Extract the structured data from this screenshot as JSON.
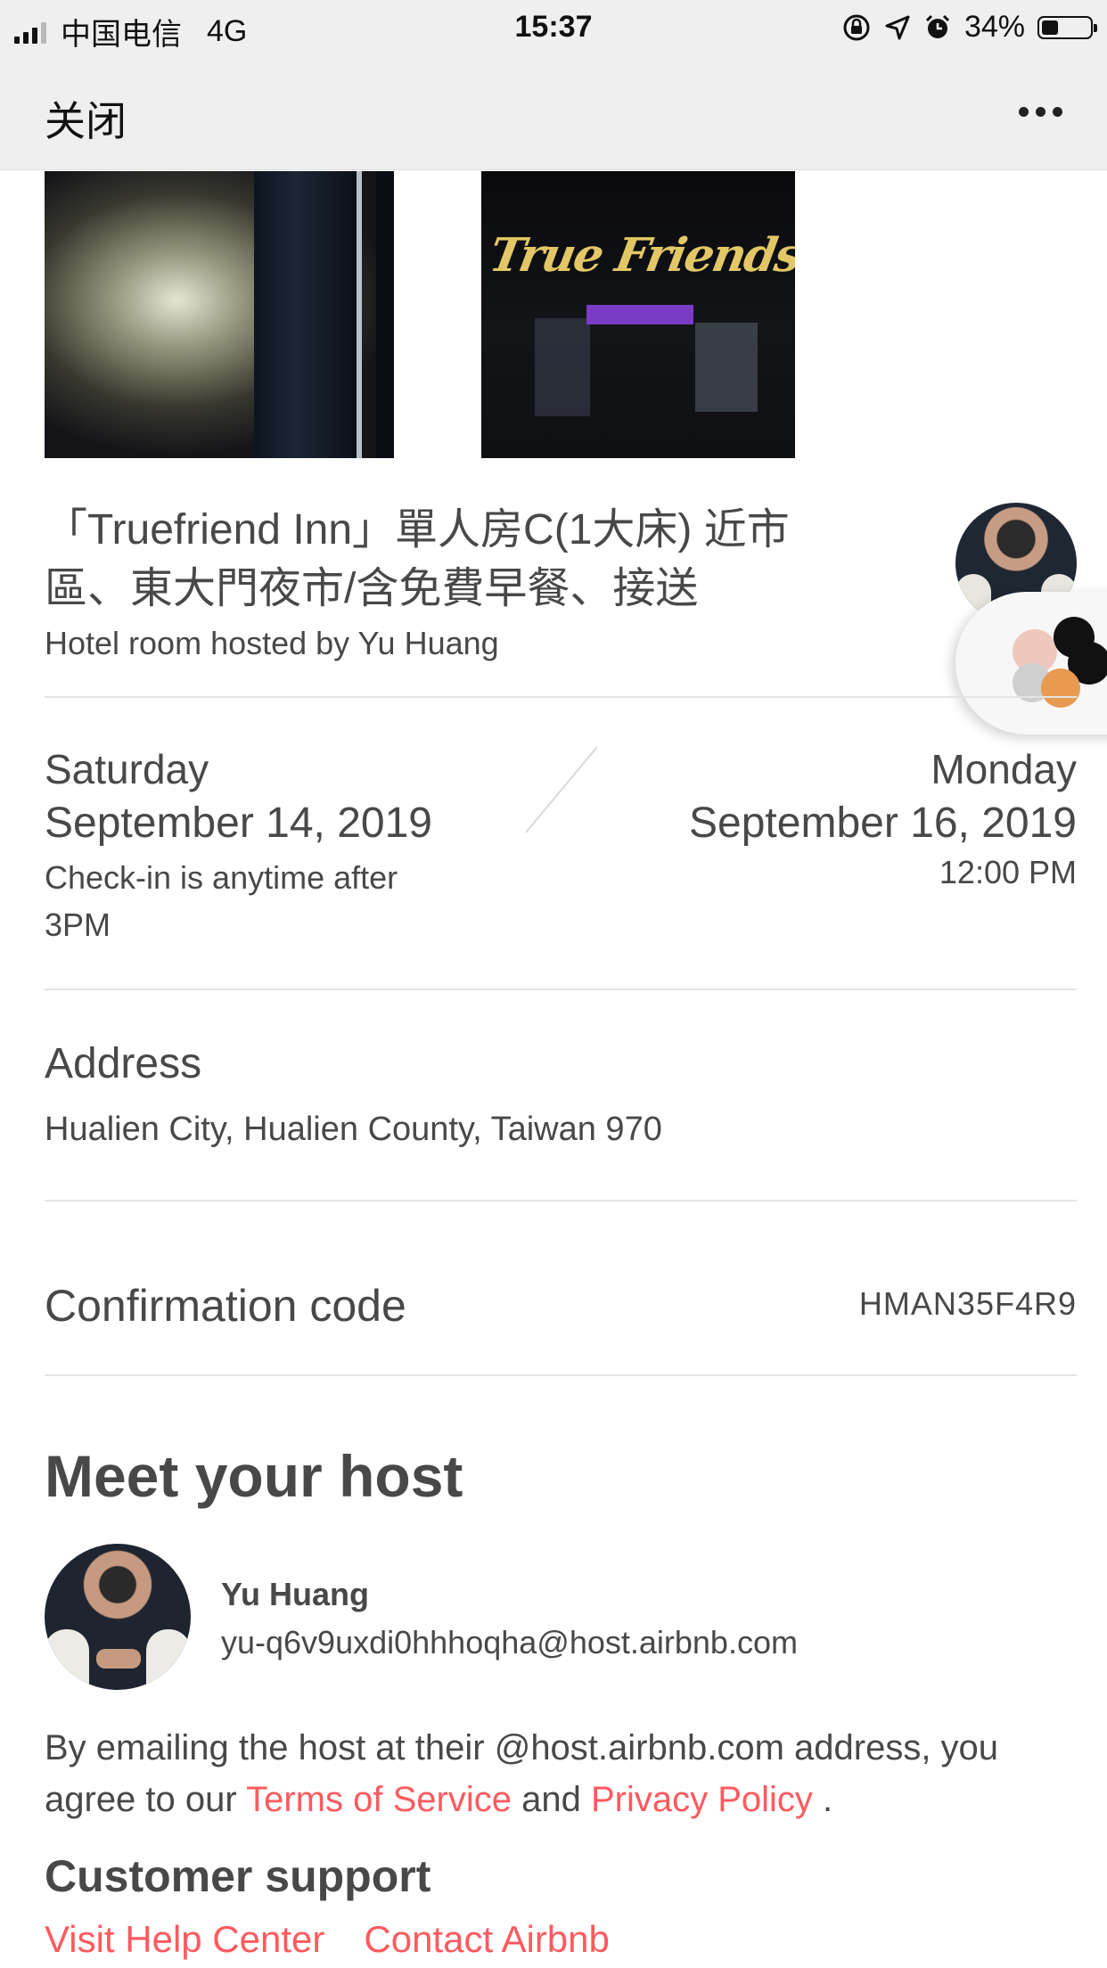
{
  "status_bar": {
    "carrier": "中国电信",
    "network": "4G",
    "time": "15:37",
    "battery": "34%",
    "battery_level": 0.34,
    "icons": [
      "signal-icon",
      "orientation-lock-icon",
      "location-icon",
      "alarm-icon",
      "battery-icon"
    ]
  },
  "nav": {
    "close_label": "关闭",
    "more_icon": "more-horizontal-icon"
  },
  "listing": {
    "photo_sign_text": "True Friends Inn",
    "title": "「Truefriend Inn」單人房C(1大床) 近市區、東大門夜市/含免費早餐、接送",
    "subtitle": "Hotel room hosted by Yu Huang"
  },
  "dates": {
    "checkin_day": "Saturday",
    "checkin_date": "September 14, 2019",
    "checkin_note": "Check-in is anytime after 3PM",
    "checkout_day": "Monday",
    "checkout_date": "September 16, 2019",
    "checkout_time": "12:00 PM"
  },
  "address": {
    "label": "Address",
    "value": "Hualien City, Hualien County, Taiwan 970"
  },
  "confirmation": {
    "label": "Confirmation code",
    "code": "HMAN35F4R9"
  },
  "host": {
    "section_title": "Meet your host",
    "name": "Yu Huang",
    "email": "yu-q6v9uxdi0hhhoqha@host.airbnb.com",
    "legal_prefix": "By emailing the host at their @host.airbnb.com address, you agree to our",
    "terms_link": "Terms of Service",
    "legal_and": "and",
    "privacy_link": "Privacy Policy",
    "legal_suffix": "."
  },
  "support": {
    "title": "Customer support",
    "help_link": "Visit Help Center",
    "contact_link": "Contact Airbnb"
  },
  "colors": {
    "link": "#ff5a5f",
    "text": "#484848",
    "bar_background": "#efefef"
  }
}
